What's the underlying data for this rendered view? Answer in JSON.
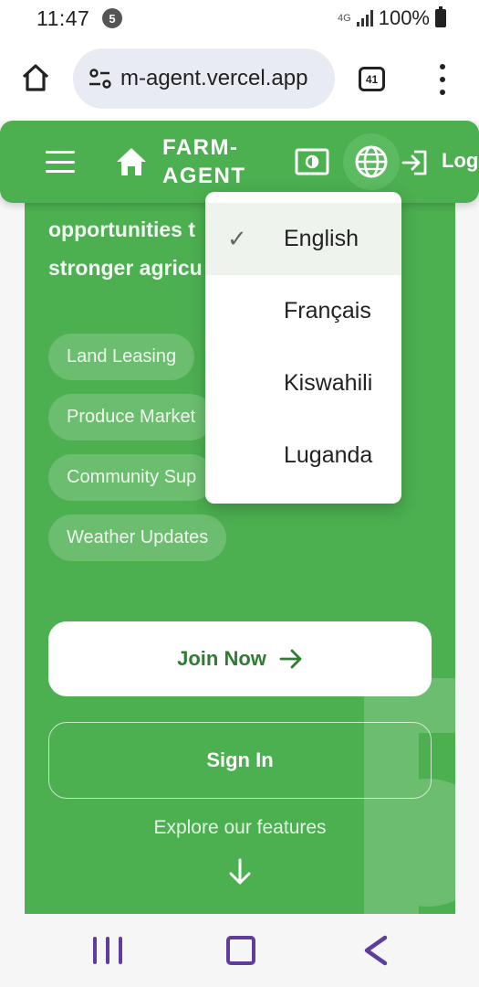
{
  "status_bar": {
    "time": "11:47",
    "notification_count": "5",
    "network": "4G",
    "battery": "100%"
  },
  "browser": {
    "url": "m-agent.vercel.app",
    "tab_count": "41"
  },
  "header": {
    "brand_line1": "FARM-",
    "brand_line2": "AGENT",
    "login_label": "Logi"
  },
  "language_menu": {
    "selected_mark": "✓",
    "items": [
      {
        "label": "English",
        "selected": true
      },
      {
        "label": "Français",
        "selected": false
      },
      {
        "label": "Kiswahili",
        "selected": false
      },
      {
        "label": "Luganda",
        "selected": false
      }
    ]
  },
  "hero": {
    "text_line1": "opportunities t",
    "text_line2": "stronger agricu",
    "features": [
      "Land Leasing",
      "Produce Market",
      "Community Sup",
      "Weather Updates"
    ],
    "join_label": "Join Now",
    "signin_label": "Sign In",
    "explore_label": "Explore our features"
  },
  "colors": {
    "primary_green": "#4caf50",
    "dark_green": "#2e7d32",
    "nav_purple": "#5e3d9c"
  }
}
